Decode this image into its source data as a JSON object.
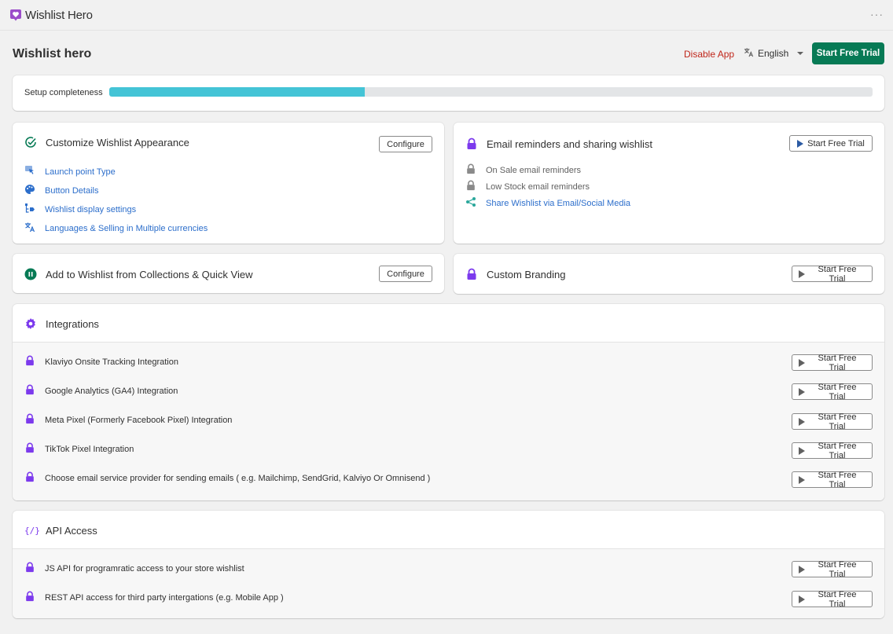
{
  "app": {
    "name": "Wishlist Hero",
    "more": "···"
  },
  "header": {
    "title": "Wishlist hero",
    "disable_label": "Disable App",
    "language": "English",
    "trial_label": "Start Free Trial"
  },
  "setup": {
    "label": "Setup completeness",
    "progress": 0.335
  },
  "customize": {
    "title": "Customize Wishlist Appearance",
    "configure": "Configure",
    "links": [
      {
        "label": "Launch point Type",
        "icon": "cursor-icon"
      },
      {
        "label": "Button Details",
        "icon": "palette-icon"
      },
      {
        "label": "Wishlist display settings",
        "icon": "tag-list-icon"
      },
      {
        "label": "Languages & Selling in Multiple currencies",
        "icon": "translate-icon"
      }
    ]
  },
  "email": {
    "title": "Email reminders and sharing wishlist",
    "trial": "Start Free Trial",
    "items": [
      {
        "label": "On Sale email reminders",
        "icon": "lock-icon"
      },
      {
        "label": "Low Stock email reminders",
        "icon": "lock-icon"
      },
      {
        "label": "Share Wishlist via Email/Social Media",
        "icon": "share-icon"
      }
    ]
  },
  "collections": {
    "title": "Add to Wishlist from Collections & Quick View",
    "configure": "Configure"
  },
  "branding": {
    "title": "Custom Branding",
    "trial": "Start Free Trial"
  },
  "integrations": {
    "title": "Integrations",
    "items": [
      {
        "label": "Klaviyo Onsite Tracking Integration",
        "trial": "Start Free Trial"
      },
      {
        "label": "Google Analytics (GA4) Integration",
        "trial": "Start Free Trial"
      },
      {
        "label": "Meta Pixel (Formerly Facebook Pixel) Integration",
        "trial": "Start Free Trial"
      },
      {
        "label": "TikTok Pixel Integration",
        "trial": "Start Free Trial"
      },
      {
        "label": "Choose email service provider for sending emails ( e.g. Mailchimp, SendGrid, Kalviyo Or Omnisend )",
        "trial": "Start Free Trial"
      }
    ]
  },
  "api": {
    "title": "API Access",
    "items": [
      {
        "label": "JS API for programratic access to your store wishlist",
        "trial": "Start Free Trial"
      },
      {
        "label": "REST API access for third party intergations (e.g. Mobile App )",
        "trial": "Start Free Trial"
      }
    ]
  },
  "colors": {
    "primary": "#077a55",
    "lock": "#7c3aed",
    "progress": "#44c4d6",
    "danger": "#c0261a",
    "link": "#2c6ecb"
  }
}
